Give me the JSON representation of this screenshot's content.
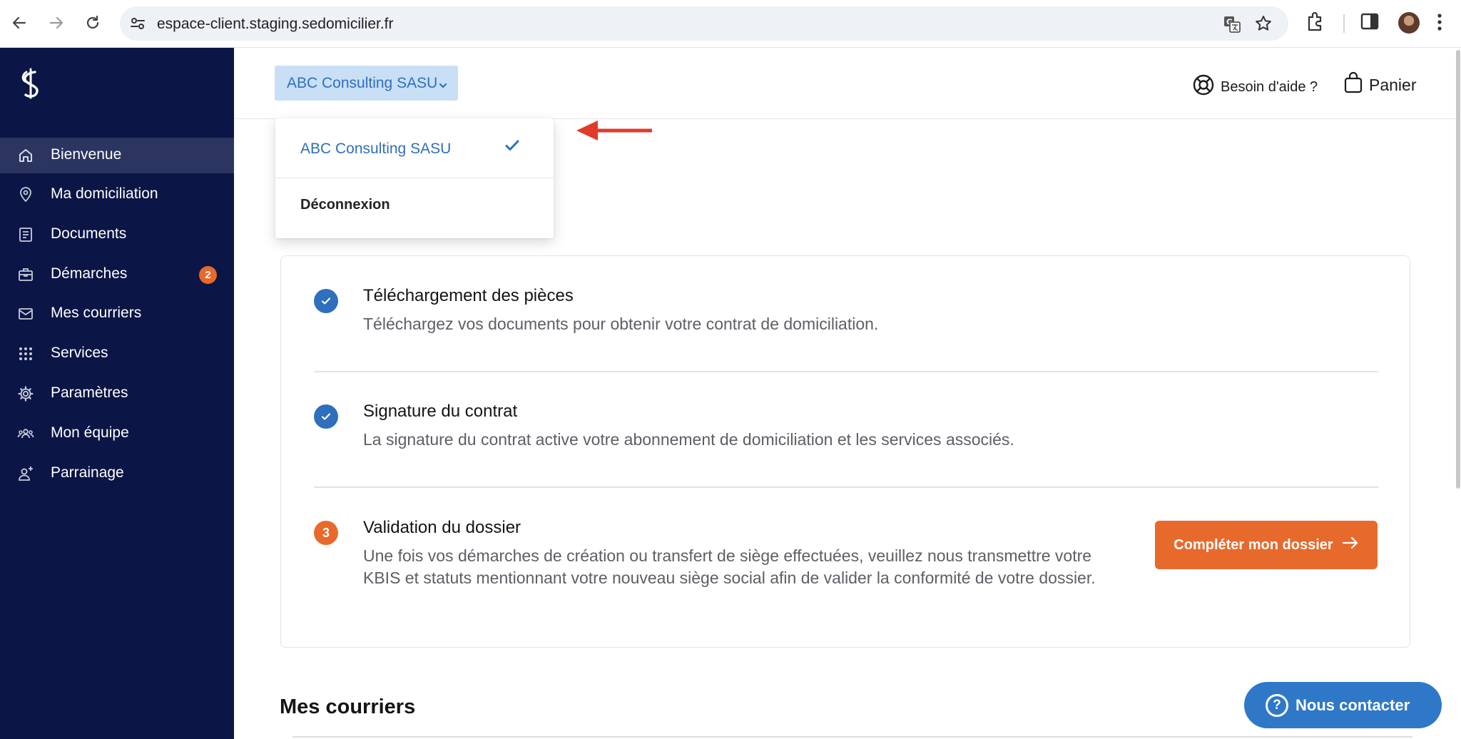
{
  "browser": {
    "url": "espace-client.staging.sedomicilier.fr",
    "icons": [
      "back-arrow-icon",
      "forward-arrow-icon",
      "reload-icon",
      "site-settings-icon",
      "translate-icon",
      "bookmark-star-icon",
      "extensions-puzzle-icon",
      "side-panel-icon",
      "profile-avatar",
      "kebab-menu-icon"
    ]
  },
  "sidebar": {
    "logo": "sedomicilier-logo",
    "items": [
      {
        "label": "Bienvenue",
        "icon": "home-icon",
        "active": true
      },
      {
        "label": "Ma domiciliation",
        "icon": "location-pin-icon"
      },
      {
        "label": "Documents",
        "icon": "document-icon"
      },
      {
        "label": "Démarches",
        "icon": "briefcase-icon",
        "badge": "2"
      },
      {
        "label": "Mes courriers",
        "icon": "envelope-icon"
      },
      {
        "label": "Services",
        "icon": "grid-dots-icon"
      },
      {
        "label": "Paramètres",
        "icon": "gear-icon"
      },
      {
        "label": "Mon équipe",
        "icon": "team-icon"
      },
      {
        "label": "Parrainage",
        "icon": "person-add-icon"
      }
    ]
  },
  "header": {
    "company_select": "ABC Consulting SASU",
    "help_label": "Besoin d'aide ?",
    "cart_label": "Panier"
  },
  "dropdown": {
    "items": [
      {
        "label": "ABC Consulting SASU",
        "selected": true
      },
      {
        "label": "Déconnexion"
      }
    ]
  },
  "steps": [
    {
      "number": "✓",
      "status": "done",
      "title": "Téléchargement des pièces",
      "description": "Téléchargez vos documents pour obtenir votre contrat de domiciliation."
    },
    {
      "number": "✓",
      "status": "done",
      "title": "Signature du contrat",
      "description": "La signature du contrat active votre abonnement de domiciliation et les services associés."
    },
    {
      "number": "3",
      "status": "pending",
      "title": "Validation du dossier",
      "description": "Une fois vos démarches de création ou transfert de siège effectuées, veuillez nous transmettre votre KBIS et statuts mentionnant votre nouveau siège social afin de valider la conformité de votre dossier.",
      "action_label": "Compléter mon dossier"
    }
  ],
  "section_title": "Mes courriers",
  "contact_button": "Nous contacter",
  "colors": {
    "sidebar_bg": "#0b1646",
    "sidebar_active": "#2b3560",
    "primary_blue": "#2f6fbd",
    "accent_orange": "#e8692c",
    "select_bg": "#c9dff6",
    "annotation_red": "#e03a2a"
  }
}
